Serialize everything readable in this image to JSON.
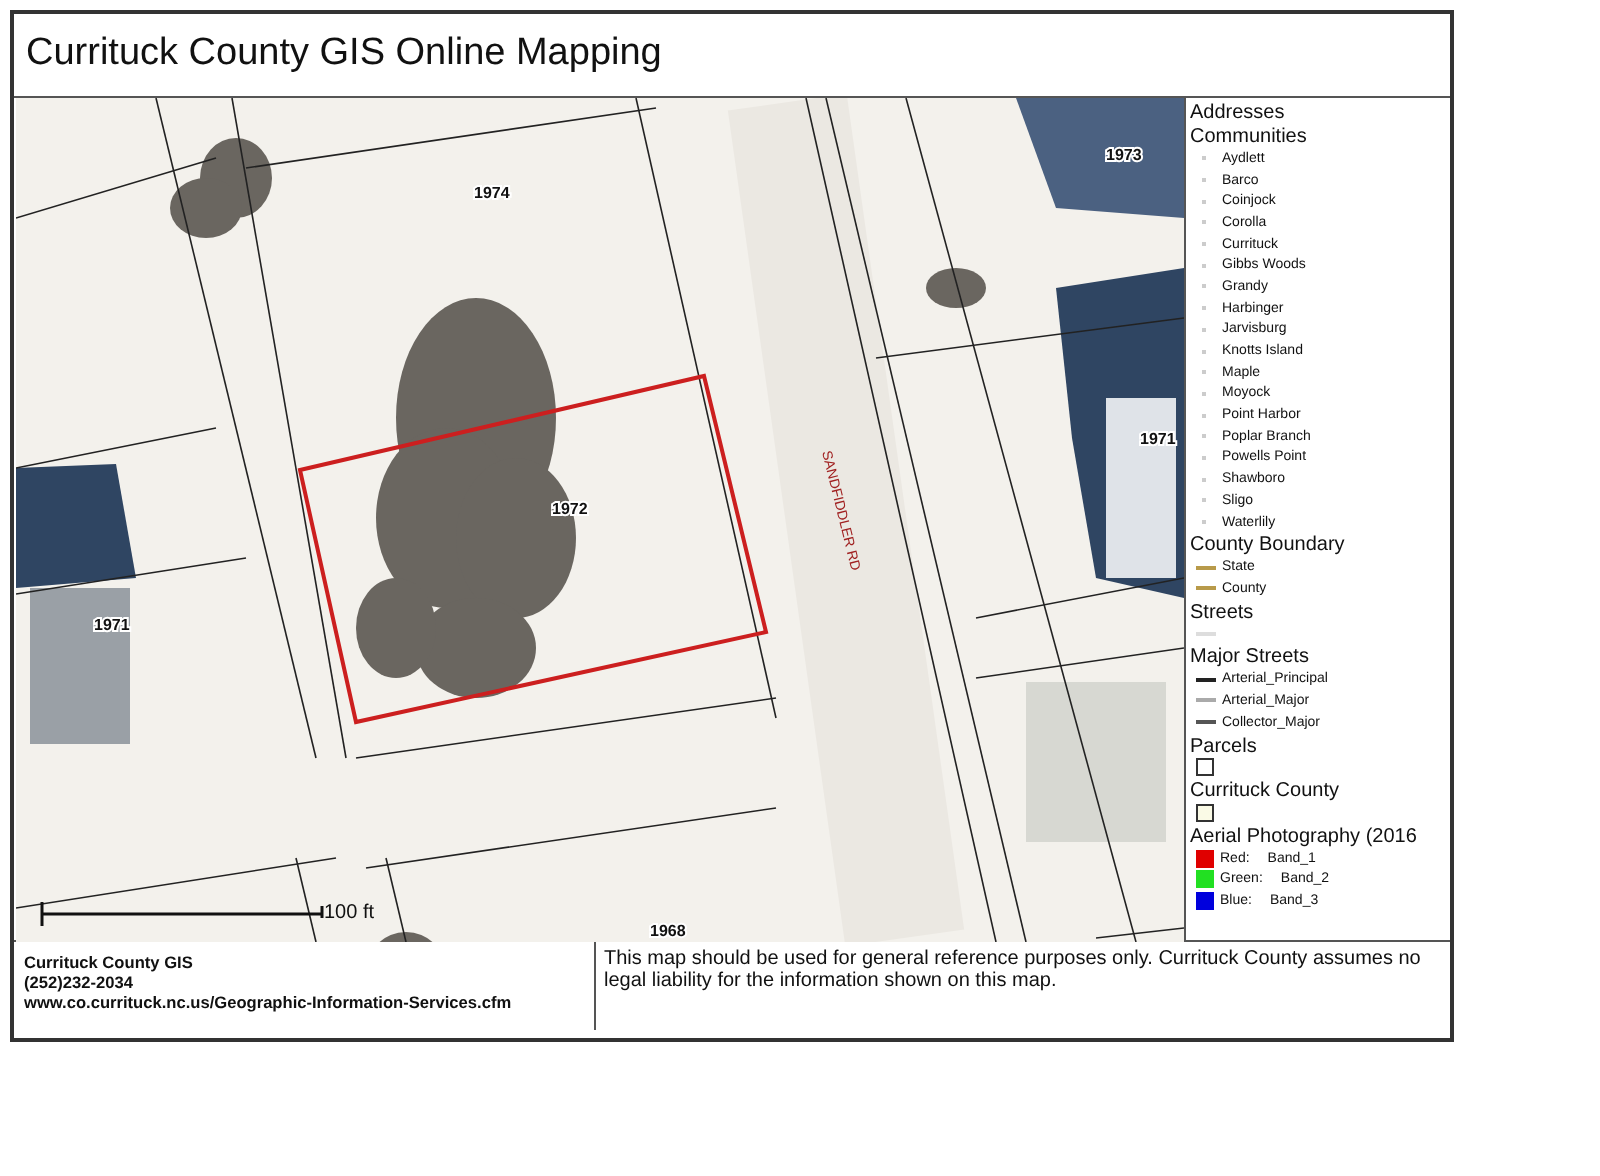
{
  "title": "Currituck County GIS Online Mapping",
  "map": {
    "parcel_labels": [
      "1974",
      "1972",
      "1971",
      "1973",
      "1971",
      "1968"
    ],
    "road_label": "SANDFIDDLER RD",
    "scale_label": "100 ft"
  },
  "legend": [
    {
      "title": "Addresses"
    },
    {
      "title": "Communities",
      "items": [
        {
          "kind": "point",
          "label": "Aydlett"
        },
        {
          "kind": "point",
          "label": "Barco"
        },
        {
          "kind": "point",
          "label": "Coinjock"
        },
        {
          "kind": "point",
          "label": "Corolla"
        },
        {
          "kind": "point",
          "label": "Currituck"
        },
        {
          "kind": "point",
          "label": "Gibbs Woods"
        },
        {
          "kind": "point",
          "label": "Grandy"
        },
        {
          "kind": "point",
          "label": "Harbinger"
        },
        {
          "kind": "point",
          "label": "Jarvisburg"
        },
        {
          "kind": "point",
          "label": "Knotts Island"
        },
        {
          "kind": "point",
          "label": "Maple"
        },
        {
          "kind": "point",
          "label": "Moyock"
        },
        {
          "kind": "point",
          "label": "Point Harbor"
        },
        {
          "kind": "point",
          "label": "Poplar Branch"
        },
        {
          "kind": "point",
          "label": "Powells Point"
        },
        {
          "kind": "point",
          "label": "Shawboro"
        },
        {
          "kind": "point",
          "label": "Sligo"
        },
        {
          "kind": "point",
          "label": "Waterlily"
        }
      ]
    },
    {
      "title": "County Boundary",
      "items": [
        {
          "kind": "line",
          "color": "#b89a4a",
          "label": "State"
        },
        {
          "kind": "line",
          "color": "#b89a4a",
          "label": "County"
        }
      ]
    },
    {
      "title": "Streets",
      "items": [
        {
          "kind": "line",
          "color": "#dddddd"
        }
      ]
    },
    {
      "title": "Major Streets",
      "items": [
        {
          "kind": "line",
          "color": "#222222",
          "label": "Arterial_Principal"
        },
        {
          "kind": "line",
          "color": "#aaaaaa",
          "label": "Arterial_Major"
        },
        {
          "kind": "line",
          "color": "#555555",
          "label": "Collector_Major"
        }
      ]
    },
    {
      "title": "Parcels",
      "items": [
        {
          "kind": "box",
          "color": "#ffffff"
        }
      ]
    },
    {
      "title": "Currituck County",
      "items": [
        {
          "kind": "box",
          "color": "#fafae6"
        }
      ]
    },
    {
      "title": "Aerial Photography (2016",
      "items": [
        {
          "kind": "swatch",
          "color": "#e00000",
          "label": "Red:",
          "value": "Band_1"
        },
        {
          "kind": "swatch",
          "color": "#22e022",
          "label": "Green:",
          "value": "Band_2"
        },
        {
          "kind": "swatch",
          "color": "#0000dd",
          "label": "Blue:",
          "value": "Band_3"
        }
      ]
    }
  ],
  "footer": {
    "org": "Currituck County GIS",
    "phone": "(252)232-2034",
    "url": "www.co.currituck.nc.us/Geographic-Information-Services.cfm",
    "disclaimer": "This map should be used for general reference purposes only. Currituck County assumes no legal liability for the information shown on this map."
  }
}
